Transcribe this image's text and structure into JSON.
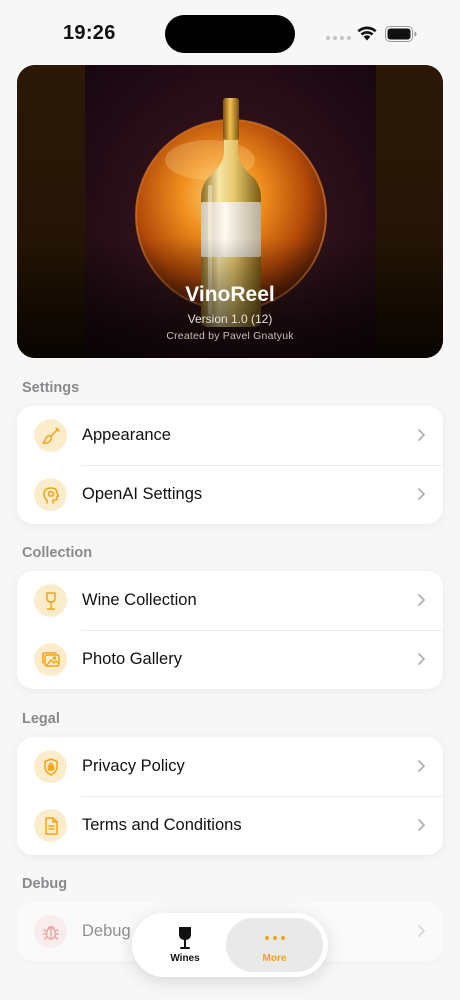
{
  "status_bar": {
    "time": "19:26"
  },
  "hero": {
    "app_name": "VinoReel",
    "version": "Version 1.0 (12)",
    "credit": "Created by Pavel Gnatyuk"
  },
  "sections": {
    "settings": {
      "header": "Settings",
      "items": [
        {
          "label": "Appearance",
          "icon": "paintbrush-icon"
        },
        {
          "label": "OpenAI Settings",
          "icon": "brain-head-icon"
        }
      ]
    },
    "collection": {
      "header": "Collection",
      "items": [
        {
          "label": "Wine Collection",
          "icon": "wine-glass-icon"
        },
        {
          "label": "Photo Gallery",
          "icon": "photo-gallery-icon"
        }
      ]
    },
    "legal": {
      "header": "Legal",
      "items": [
        {
          "label": "Privacy Policy",
          "icon": "shield-lock-icon"
        },
        {
          "label": "Terms and Conditions",
          "icon": "document-icon"
        }
      ]
    },
    "debug": {
      "header": "Debug",
      "items": [
        {
          "label": "Debug",
          "icon": "bug-icon"
        }
      ]
    }
  },
  "tab_bar": {
    "tabs": [
      {
        "label": "Wines",
        "icon": "wine-glass-icon",
        "selected": false
      },
      {
        "label": "More",
        "icon": "ellipsis-icon",
        "selected": true
      }
    ]
  },
  "colors": {
    "accent": "#f2a418",
    "icon_background": "#fbeccb",
    "section_header": "#8a8a8e"
  }
}
